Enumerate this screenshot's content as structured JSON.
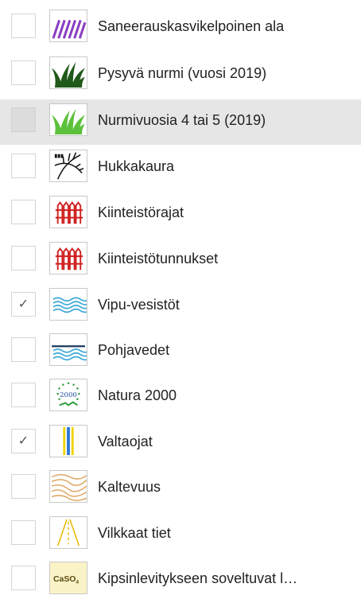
{
  "layers": [
    {
      "label": "Saneerauskasvikelpoinen ala",
      "checked": false,
      "icon": "purple-hatch-icon"
    },
    {
      "label": "Pysyvä nurmi (vuosi 2019)",
      "checked": false,
      "icon": "dark-grass-icon"
    },
    {
      "label": "Nurmivuosia 4 tai 5 (2019)",
      "checked": false,
      "icon": "light-grass-icon"
    },
    {
      "label": "Hukkakaura",
      "checked": false,
      "icon": "wild-oat-icon"
    },
    {
      "label": "Kiinteistörajat",
      "checked": false,
      "icon": "red-fence-icon"
    },
    {
      "label": "Kiinteistötunnukset",
      "checked": false,
      "icon": "red-fence-icon"
    },
    {
      "label": "Vipu-vesistöt",
      "checked": true,
      "icon": "water-waves-icon"
    },
    {
      "label": "Pohjavedet",
      "checked": false,
      "icon": "groundwater-icon"
    },
    {
      "label": "Natura 2000",
      "checked": false,
      "icon": "natura-2000-icon"
    },
    {
      "label": "Valtaojat",
      "checked": true,
      "icon": "main-ditch-icon"
    },
    {
      "label": "Kaltevuus",
      "checked": false,
      "icon": "contour-lines-icon"
    },
    {
      "label": "Vilkkaat tiet",
      "checked": false,
      "icon": "road-icon"
    },
    {
      "label": "Kipsinlevitykseen soveltuvat l…",
      "checked": false,
      "icon": "caso4-icon"
    }
  ],
  "checkmark": "✓",
  "natura_icon_text": "2000",
  "caso4_icon_text": "CaSO",
  "caso4_icon_subscript": "4",
  "colors": {
    "highlight_row": "#e6e6e6",
    "hatch_purple": "#8a3fc0",
    "grass_dark": "#1f5a1a",
    "grass_light": "#5cc23b",
    "fence_red": "#d02020",
    "water_blue": "#3fa9d8",
    "groundwater_dark": "#1d3a5f",
    "ditch_blue": "#2a78d6",
    "ditch_yellow": "#f2d200",
    "contour_orange": "#e0a864",
    "caso4_bg": "#fbf3c8"
  }
}
